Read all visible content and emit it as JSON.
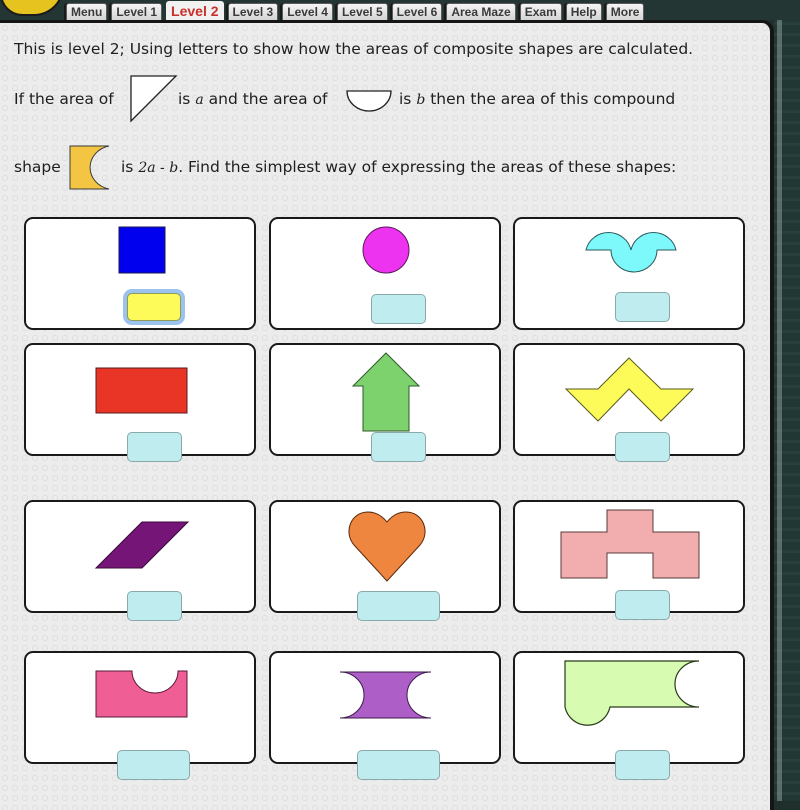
{
  "nav": {
    "tabs": [
      {
        "label": "Menu",
        "active": false
      },
      {
        "label": "Level 1",
        "active": false
      },
      {
        "label": "Level 2",
        "active": true
      },
      {
        "label": "Level 3",
        "active": false
      },
      {
        "label": "Level 4",
        "active": false
      },
      {
        "label": "Level 5",
        "active": false
      },
      {
        "label": "Level 6",
        "active": false
      },
      {
        "label": "Area Maze",
        "active": false
      },
      {
        "label": "Exam",
        "active": false
      },
      {
        "label": "Help",
        "active": false
      },
      {
        "label": "More",
        "active": false
      }
    ]
  },
  "intro": {
    "line1": "This is level 2; Using letters to show how the areas of composite shapes are calculated.",
    "line2_a": "If the area of",
    "line2_b": "is",
    "var_a": "a",
    "line2_c": "and the area of",
    "line2_d": "is",
    "var_b": "b",
    "line2_e": "then the area of this compound",
    "line3_a": "shape",
    "line3_b": "is",
    "expression": "2a - b",
    "line3_c": ". Find the simplest way of expressing the areas of these shapes:"
  },
  "inline_shapes": {
    "triangle": {
      "name": "right-triangle",
      "fill": "#ffffff"
    },
    "semicircle": {
      "name": "semicircle",
      "fill": "#ffffff"
    },
    "compound": {
      "name": "rectangle-minus-semicircle",
      "fill": "#f4c542"
    }
  },
  "cards": [
    {
      "shape": "square",
      "fill": "#0000ee",
      "answer": "",
      "selected": true
    },
    {
      "shape": "circle",
      "fill": "#ee33f0",
      "answer": "",
      "selected": false
    },
    {
      "shape": "double-arch",
      "fill": "#7df8fb",
      "answer": "",
      "selected": false
    },
    {
      "shape": "rectangle",
      "fill": "#e83525",
      "answer": "",
      "selected": false
    },
    {
      "shape": "arrow-up",
      "fill": "#7ed26e",
      "answer": "",
      "selected": false
    },
    {
      "shape": "zigzag",
      "fill": "#fdfb5a",
      "answer": "",
      "selected": false
    },
    {
      "shape": "parallelogram",
      "fill": "#751577",
      "answer": "",
      "selected": false
    },
    {
      "shape": "heart",
      "fill": "#ef8640",
      "answer": "",
      "selected": false
    },
    {
      "shape": "stepped-block",
      "fill": "#f2aeae",
      "answer": "",
      "selected": false
    },
    {
      "shape": "rectangle-with-notch",
      "fill": "#ef5f96",
      "answer": "",
      "selected": false
    },
    {
      "shape": "concave-hourglass",
      "fill": "#ad5fc7",
      "answer": "",
      "selected": false
    },
    {
      "shape": "flag-with-bulge",
      "fill": "#d6fbb1",
      "answer": "",
      "selected": false
    }
  ]
}
